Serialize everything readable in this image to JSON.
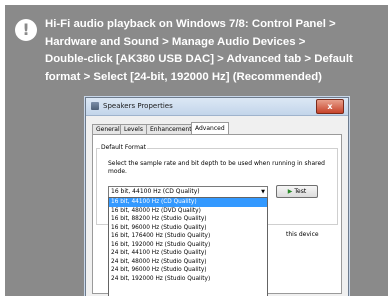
{
  "instructions": {
    "lines": [
      "Hi-Fi audio playback on Windows 7/8: Control Panel >",
      "Hardware and Sound > Manage Audio Devices >",
      "Double-click [AK380 USB DAC] > Advanced tab > Default",
      "format > Select [24-bit, 192000 Hz] (Recommended)"
    ]
  },
  "dialog": {
    "title": "Speakers Properties",
    "close_glyph": "x",
    "tabs": [
      "General",
      "Levels",
      "Enhancements",
      "Advanced"
    ],
    "active_tab": "Advanced",
    "group_label": "Default Format",
    "description": "Select the sample rate and bit depth to be used when running in shared mode.",
    "selected_format": "16 bit, 44100 Hz (CD Quality)",
    "test_label": "Test",
    "right_text": "this device",
    "options": [
      "16 bit, 44100 Hz (CD Quality)",
      "16 bit, 48000 Hz (DVD Quality)",
      "16 bit, 88200 Hz (Studio Quality)",
      "16 bit, 96000 Hz (Studio Quality)",
      "16 bit, 176400 Hz (Studio Quality)",
      "16 bit, 192000 Hz (Studio Quality)",
      "24 bit, 44100 Hz (Studio Quality)",
      "24 bit, 48000 Hz (Studio Quality)",
      "24 bit, 96000 Hz (Studio Quality)",
      "24 bit, 192000 Hz (Studio Quality)"
    ]
  },
  "icons": {
    "info": "exclamation-icon",
    "play": "play-icon"
  }
}
